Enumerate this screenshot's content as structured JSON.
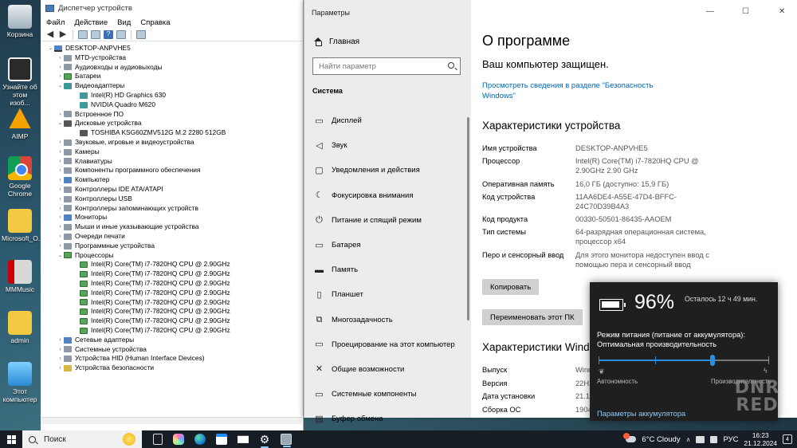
{
  "desktop": {
    "icons": [
      {
        "label": "Корзина",
        "icon": "recycle-bin-icon"
      },
      {
        "label": "Узнайте об этом изоб...",
        "icon": "spotlight-icon"
      },
      {
        "label": "AIMP",
        "icon": "aimp-icon"
      },
      {
        "label": "Google Chrome",
        "icon": "chrome-icon"
      },
      {
        "label": "Microsoft_O...",
        "icon": "folder-icon"
      },
      {
        "label": "MMMusic",
        "icon": "music-icon"
      },
      {
        "label": "admin",
        "icon": "user-folder-icon"
      },
      {
        "label": "Этот компьютер",
        "icon": "this-pc-icon"
      }
    ]
  },
  "device_manager": {
    "title": "Диспетчер устройств",
    "menu": [
      "Файл",
      "Действие",
      "Вид",
      "Справка"
    ],
    "tree": [
      {
        "level": 0,
        "exp": "⌄",
        "icon": "c-pc",
        "label": "DESKTOP-ANPVHE5"
      },
      {
        "level": 1,
        "exp": "›",
        "icon": "c-gray",
        "label": "MTD-устройства"
      },
      {
        "level": 1,
        "exp": "›",
        "icon": "c-gray",
        "label": "Аудиовходы и аудиовыходы"
      },
      {
        "level": 1,
        "exp": "›",
        "icon": "c-green",
        "label": "Батареи"
      },
      {
        "level": 1,
        "exp": "⌄",
        "icon": "c-teal",
        "label": "Видеоадаптеры"
      },
      {
        "level": 2,
        "exp": "",
        "icon": "c-teal",
        "label": "Intel(R) HD Graphics 630"
      },
      {
        "level": 2,
        "exp": "",
        "icon": "c-teal",
        "label": "NVIDIA Quadro M620"
      },
      {
        "level": 1,
        "exp": "›",
        "icon": "c-gray",
        "label": "Встроенное ПО"
      },
      {
        "level": 1,
        "exp": "⌄",
        "icon": "c-dark",
        "label": "Дисковые устройства"
      },
      {
        "level": 2,
        "exp": "",
        "icon": "c-dark",
        "label": "TOSHIBA KSG60ZMV512G M.2 2280 512GB"
      },
      {
        "level": 1,
        "exp": "›",
        "icon": "c-gray",
        "label": "Звуковые, игровые и видеоустройства"
      },
      {
        "level": 1,
        "exp": "›",
        "icon": "c-gray",
        "label": "Камеры"
      },
      {
        "level": 1,
        "exp": "›",
        "icon": "c-gray",
        "label": "Клавиатуры"
      },
      {
        "level": 1,
        "exp": "›",
        "icon": "c-gray",
        "label": "Компоненты программного обеспечения"
      },
      {
        "level": 1,
        "exp": "›",
        "icon": "c-blue",
        "label": "Компьютер"
      },
      {
        "level": 1,
        "exp": "›",
        "icon": "c-gray",
        "label": "Контроллеры IDE ATA/ATAPI"
      },
      {
        "level": 1,
        "exp": "›",
        "icon": "c-gray",
        "label": "Контроллеры USB"
      },
      {
        "level": 1,
        "exp": "›",
        "icon": "c-gray",
        "label": "Контроллеры запоминающих устройств"
      },
      {
        "level": 1,
        "exp": "›",
        "icon": "c-blue",
        "label": "Мониторы"
      },
      {
        "level": 1,
        "exp": "›",
        "icon": "c-gray",
        "label": "Мыши и иные указывающие устройства"
      },
      {
        "level": 1,
        "exp": "›",
        "icon": "c-gray",
        "label": "Очереди печати"
      },
      {
        "level": 1,
        "exp": "›",
        "icon": "c-gray",
        "label": "Программные устройства"
      },
      {
        "level": 1,
        "exp": "⌄",
        "icon": "c-green",
        "label": "Процессоры"
      },
      {
        "level": 2,
        "exp": "",
        "icon": "c-green",
        "label": "Intel(R) Core(TM) i7-7820HQ CPU @ 2.90GHz"
      },
      {
        "level": 2,
        "exp": "",
        "icon": "c-green",
        "label": "Intel(R) Core(TM) i7-7820HQ CPU @ 2.90GHz"
      },
      {
        "level": 2,
        "exp": "",
        "icon": "c-green",
        "label": "Intel(R) Core(TM) i7-7820HQ CPU @ 2.90GHz"
      },
      {
        "level": 2,
        "exp": "",
        "icon": "c-green",
        "label": "Intel(R) Core(TM) i7-7820HQ CPU @ 2.90GHz"
      },
      {
        "level": 2,
        "exp": "",
        "icon": "c-green",
        "label": "Intel(R) Core(TM) i7-7820HQ CPU @ 2.90GHz"
      },
      {
        "level": 2,
        "exp": "",
        "icon": "c-green",
        "label": "Intel(R) Core(TM) i7-7820HQ CPU @ 2.90GHz"
      },
      {
        "level": 2,
        "exp": "",
        "icon": "c-green",
        "label": "Intel(R) Core(TM) i7-7820HQ CPU @ 2.90GHz"
      },
      {
        "level": 2,
        "exp": "",
        "icon": "c-green",
        "label": "Intel(R) Core(TM) i7-7820HQ CPU @ 2.90GHz"
      },
      {
        "level": 1,
        "exp": "›",
        "icon": "c-blue",
        "label": "Сетевые адаптеры"
      },
      {
        "level": 1,
        "exp": "›",
        "icon": "c-gray",
        "label": "Системные устройства"
      },
      {
        "level": 1,
        "exp": "›",
        "icon": "c-gray",
        "label": "Устройства HID (Human Interface Devices)"
      },
      {
        "level": 1,
        "exp": "›",
        "icon": "c-yellow",
        "label": "Устройства безопасности"
      }
    ]
  },
  "settings": {
    "window_title": "Параметры",
    "home": "Главная",
    "search_placeholder": "Найти параметр",
    "section": "Система",
    "nav": [
      {
        "label": "Дисплей",
        "icon": "display-icon",
        "glyph": "▭"
      },
      {
        "label": "Звук",
        "icon": "sound-icon",
        "glyph": "◁"
      },
      {
        "label": "Уведомления и действия",
        "icon": "notifications-icon",
        "glyph": "▢"
      },
      {
        "label": "Фокусировка внимания",
        "icon": "focus-assist-icon",
        "glyph": "☾"
      },
      {
        "label": "Питание и спящий режим",
        "icon": "power-icon",
        "glyph": "⏻"
      },
      {
        "label": "Батарея",
        "icon": "battery-icon",
        "glyph": "▭"
      },
      {
        "label": "Память",
        "icon": "storage-icon",
        "glyph": "▬"
      },
      {
        "label": "Планшет",
        "icon": "tablet-icon",
        "glyph": "▯"
      },
      {
        "label": "Многозадачность",
        "icon": "multitasking-icon",
        "glyph": "⧉"
      },
      {
        "label": "Проецирование на этот компьютер",
        "icon": "projecting-icon",
        "glyph": "▭"
      },
      {
        "label": "Общие возможности",
        "icon": "shared-experiences-icon",
        "glyph": "✕"
      },
      {
        "label": "Системные компоненты",
        "icon": "system-components-icon",
        "glyph": "▭"
      },
      {
        "label": "Буфер обмена",
        "icon": "clipboard-icon",
        "glyph": "▤"
      }
    ],
    "about_heading": "О программе",
    "protected_text": "Ваш компьютер защищен.",
    "security_link": "Просмотреть сведения в разделе \"Безопасность Windows\"",
    "device_specs_heading": "Характеристики устройства",
    "device_specs": [
      {
        "key": "Имя устройства",
        "value": "DESKTOP-ANPVHE5"
      },
      {
        "key": "Процессор",
        "value": "Intel(R) Core(TM) i7-7820HQ CPU @ 2.90GHz   2.90 GHz"
      },
      {
        "key": "Оперативная память",
        "value": "16,0 ГБ (доступно: 15,9 ГБ)"
      },
      {
        "key": "Код устройства",
        "value": "11AA6DE4-A55E-47D4-BFFC-24C70D39B4A3"
      },
      {
        "key": "Код продукта",
        "value": "00330-50501-86435-AAOEM"
      },
      {
        "key": "Тип системы",
        "value": "64-разрядная операционная система, процессор x64"
      },
      {
        "key": "Перо и сенсорный ввод",
        "value": "Для этого монитора недоступен ввод с помощью пера и сенсорный ввод"
      }
    ],
    "copy_button": "Копировать",
    "rename_button": "Переименовать этот ПК",
    "windows_specs_heading": "Характеристики Windo",
    "windows_specs": [
      {
        "key": "Выпуск",
        "value": "Wind"
      },
      {
        "key": "Версия",
        "value": "22H2"
      },
      {
        "key": "Дата установки",
        "value": "21.12"
      },
      {
        "key": "Сборка ОС",
        "value": "1904"
      }
    ]
  },
  "battery": {
    "percent_value": 0.96,
    "percent_text": "96%",
    "remaining": "Осталось 12 ч 49 мин.",
    "mode_label": "Режим питания (питание от аккумулятора):",
    "mode_value": "Оптимальная производительность",
    "slider_position": 0.67,
    "left_label": "Автономность",
    "right_label": "Производительность",
    "settings_link": "Параметры аккумулятора"
  },
  "watermark": "DNR RED",
  "taskbar": {
    "search_label": "Поиск",
    "weather": "6°C  Cloudy",
    "language": "РУС",
    "time": "16:23",
    "date": "21.12.2024",
    "notifications_count": "4"
  }
}
